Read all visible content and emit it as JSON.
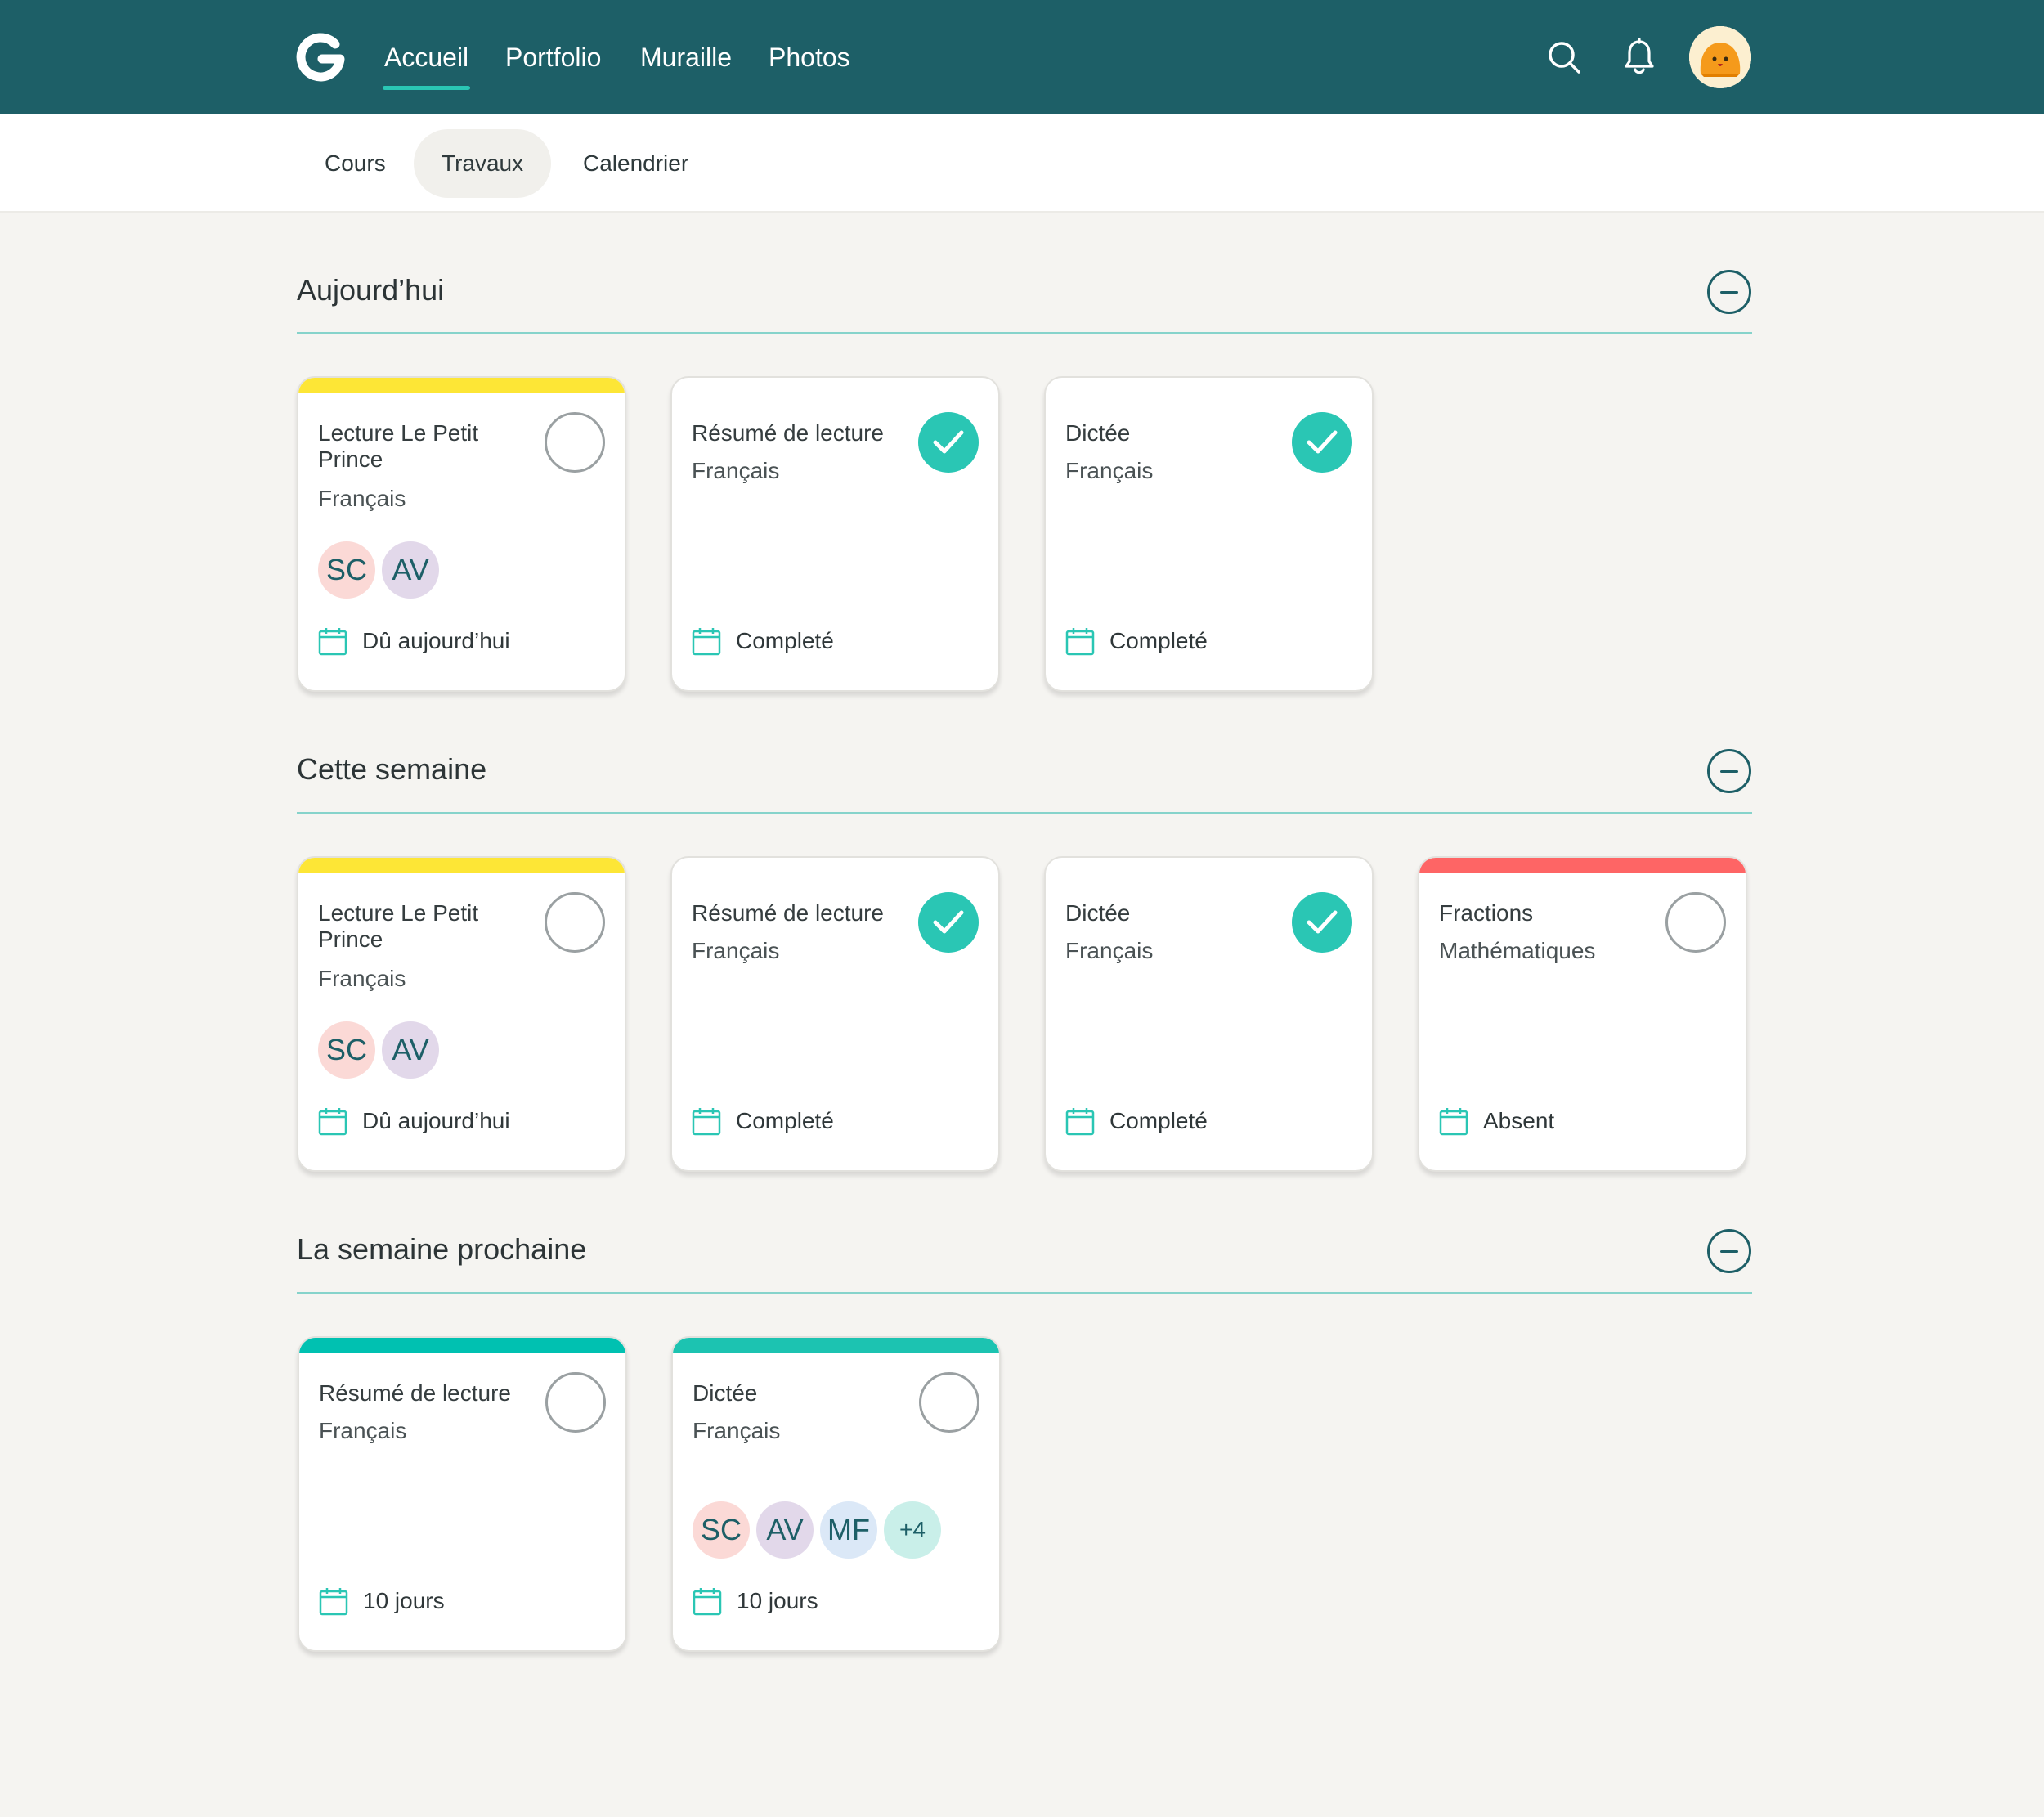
{
  "nav": {
    "items": [
      {
        "label": "Accueil",
        "active": true
      },
      {
        "label": "Portfolio",
        "active": false
      },
      {
        "label": "Muraille",
        "active": false
      },
      {
        "label": "Photos",
        "active": false
      }
    ],
    "icons": [
      "search-icon",
      "bell-icon",
      "user-avatar"
    ]
  },
  "subnav": {
    "tabs": [
      {
        "label": "Cours",
        "active": false
      },
      {
        "label": "Travaux",
        "active": true
      },
      {
        "label": "Calendrier",
        "active": false
      }
    ]
  },
  "colors": {
    "primary": "#1d5f67",
    "accent": "#2ac6b4",
    "yellow": "#fde636",
    "red": "#fe6565",
    "teal": "#00c1b1"
  },
  "sections": [
    {
      "title": "Aujourd’hui",
      "cards": [
        {
          "title": "Lecture Le Petit Prince",
          "subject": "Français",
          "status": "Dû aujourd’hui",
          "done": false,
          "stripe": "#fde636",
          "avatars": [
            "SC",
            "AV"
          ]
        },
        {
          "title": "Résumé de lecture",
          "subject": "Français",
          "status": "Completé",
          "done": true,
          "stripe": "",
          "avatars": []
        },
        {
          "title": "Dictée",
          "subject": "Français",
          "status": "Completé",
          "done": true,
          "stripe": "",
          "avatars": []
        }
      ]
    },
    {
      "title": "Cette semaine",
      "cards": [
        {
          "title": "Lecture Le Petit Prince",
          "subject": "Français",
          "status": "Dû aujourd’hui",
          "done": false,
          "stripe": "#fde636",
          "avatars": [
            "SC",
            "AV"
          ]
        },
        {
          "title": "Résumé de lecture",
          "subject": "Français",
          "status": "Completé",
          "done": true,
          "stripe": "",
          "avatars": []
        },
        {
          "title": "Dictée",
          "subject": "Français",
          "status": "Completé",
          "done": true,
          "stripe": "",
          "avatars": []
        },
        {
          "title": "Fractions",
          "subject": "Mathématiques",
          "status": "Absent",
          "done": false,
          "stripe": "#fe6565",
          "avatars": []
        }
      ]
    },
    {
      "title": "La semaine prochaine",
      "cards": [
        {
          "title": "Résumé de lecture",
          "subject": "Français",
          "status": "10 jours",
          "done": false,
          "stripe": "#00c1b1",
          "avatars": []
        },
        {
          "title": "Dictée",
          "subject": "Français",
          "status": "10 jours",
          "done": false,
          "stripe": "#1cc3b1",
          "avatars": [
            "SC",
            "AV",
            "MF",
            "+4"
          ]
        }
      ]
    }
  ]
}
